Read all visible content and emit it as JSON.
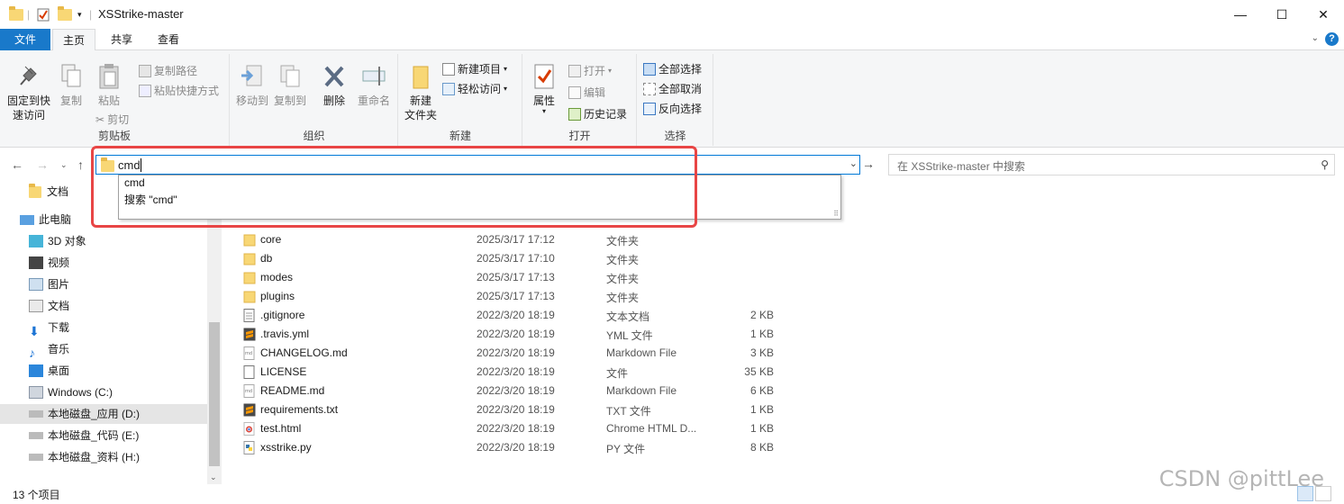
{
  "window": {
    "title": "XSStrike-master"
  },
  "title_controls": {
    "minimize": "—",
    "maximize": "☐",
    "close": "✕"
  },
  "ribbon_tabs": [
    {
      "label": "文件"
    },
    {
      "label": "主页"
    },
    {
      "label": "共享"
    },
    {
      "label": "查看"
    }
  ],
  "ribbon": {
    "clipboard": {
      "label": "剪贴板",
      "pin": "固定到快\n速访问",
      "pin_l1": "固定到快",
      "pin_l2": "速访问",
      "copy": "复制",
      "paste": "粘贴",
      "copy_path": "复制路径",
      "paste_shortcut": "粘贴快捷方式",
      "cut": "剪切"
    },
    "organize": {
      "label": "组织",
      "move_to": "移动到",
      "copy_to": "复制到",
      "delete": "删除",
      "rename": "重命名"
    },
    "new": {
      "label": "新建",
      "new_folder_l1": "新建",
      "new_folder_l2": "文件夹",
      "new_item": "新建项目",
      "easy_access": "轻松访问"
    },
    "open": {
      "label": "打开",
      "properties": "属性",
      "open": "打开",
      "edit": "编辑",
      "history": "历史记录"
    },
    "select": {
      "label": "选择",
      "select_all": "全部选择",
      "select_none": "全部取消",
      "invert": "反向选择"
    }
  },
  "address": {
    "value": "cmd"
  },
  "search": {
    "placeholder": "在 XSStrike-master 中搜索"
  },
  "suggestions": [
    {
      "label": "cmd"
    },
    {
      "label": "搜索 \"cmd\""
    }
  ],
  "nav_pane": {
    "items": [
      {
        "label": "文档"
      },
      {
        "label": "此电脑"
      },
      {
        "label": "3D 对象"
      },
      {
        "label": "视频"
      },
      {
        "label": "图片"
      },
      {
        "label": "文档"
      },
      {
        "label": "下载"
      },
      {
        "label": "音乐"
      },
      {
        "label": "桌面"
      },
      {
        "label": "Windows (C:)"
      },
      {
        "label": "本地磁盘_应用 (D:)"
      },
      {
        "label": "本地磁盘_代码 (E:)"
      },
      {
        "label": "本地磁盘_资料 (H:)"
      }
    ]
  },
  "files": [
    {
      "name": "core",
      "date": "2025/3/17 17:12",
      "type": "文件夹",
      "size": "",
      "icon": "folder-icon"
    },
    {
      "name": "db",
      "date": "2025/3/17 17:10",
      "type": "文件夹",
      "size": "",
      "icon": "folder-icon"
    },
    {
      "name": "modes",
      "date": "2025/3/17 17:13",
      "type": "文件夹",
      "size": "",
      "icon": "folder-icon"
    },
    {
      "name": "plugins",
      "date": "2025/3/17 17:13",
      "type": "文件夹",
      "size": "",
      "icon": "folder-icon"
    },
    {
      "name": ".gitignore",
      "date": "2022/3/20 18:19",
      "type": "文本文档",
      "size": "2 KB",
      "icon": "text-file-icon"
    },
    {
      "name": ".travis.yml",
      "date": "2022/3/20 18:19",
      "type": "YML 文件",
      "size": "1 KB",
      "icon": "sublime-file-icon"
    },
    {
      "name": "CHANGELOG.md",
      "date": "2022/3/20 18:19",
      "type": "Markdown File",
      "size": "3 KB",
      "icon": "markdown-file-icon"
    },
    {
      "name": "LICENSE",
      "date": "2022/3/20 18:19",
      "type": "文件",
      "size": "35 KB",
      "icon": "blank-file-icon"
    },
    {
      "name": "README.md",
      "date": "2022/3/20 18:19",
      "type": "Markdown File",
      "size": "6 KB",
      "icon": "markdown-file-icon"
    },
    {
      "name": "requirements.txt",
      "date": "2022/3/20 18:19",
      "type": "TXT 文件",
      "size": "1 KB",
      "icon": "sublime-file-icon"
    },
    {
      "name": "test.html",
      "date": "2022/3/20 18:19",
      "type": "Chrome HTML D...",
      "size": "1 KB",
      "icon": "chrome-file-icon"
    },
    {
      "name": "xsstrike.py",
      "date": "2022/3/20 18:19",
      "type": "PY 文件",
      "size": "8 KB",
      "icon": "python-file-icon"
    }
  ],
  "status": {
    "count": "13 个项目"
  },
  "watermark": "CSDN @pittLee",
  "colors": {
    "accent": "#1979ca",
    "highlight_box": "#e84545",
    "folder": "#f8d775"
  }
}
